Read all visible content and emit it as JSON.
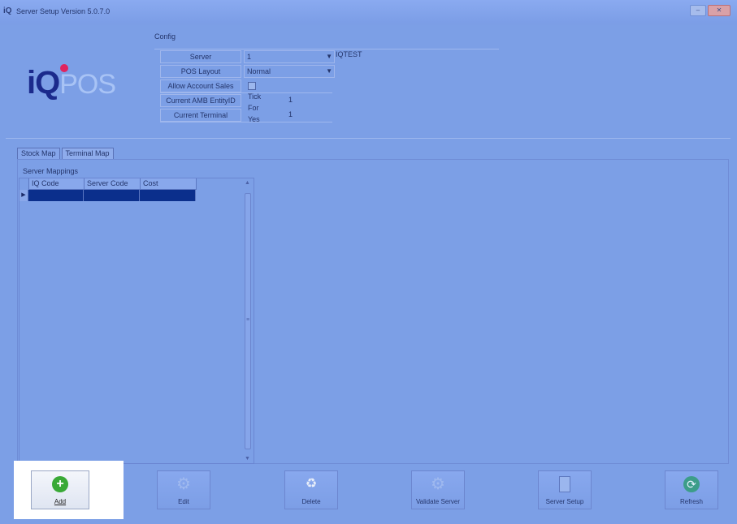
{
  "window": {
    "title": "Server Setup Version 5.0.7.0",
    "title_logo": "iQ",
    "buttons": [
      "–",
      "✕"
    ]
  },
  "logo": {
    "iq": "iQ",
    "pos": "POS"
  },
  "config": {
    "title": "Config",
    "server_label": "Server",
    "server_value": "1",
    "server_name": "IQTEST",
    "pos_layout_label": "POS Layout",
    "pos_layout_value": "Normal",
    "allow_account_sales_label": "Allow Account Sales",
    "allow_account_sales_checkbox": "Tick For Yes",
    "amb_entity_label": "Current AMB EntityID",
    "amb_entity_value": "1",
    "terminal_label": "Current Terminal",
    "terminal_value": "1"
  },
  "tabs": [
    "Stock Map",
    "Terminal Map"
  ],
  "mappings": {
    "group_label": "Server Mappings",
    "columns": [
      "IQ Code",
      "Server Code",
      "Cost"
    ],
    "row_indicator": "▶"
  },
  "toolbar": {
    "add": "Add",
    "edit": "Edit",
    "delete": "Delete",
    "validate": "Validate Server",
    "server_setup": "Server Setup",
    "refresh": "Refresh"
  },
  "colors": {
    "background": "#7c9fe6",
    "selected_row": "#0b2f8c",
    "logo_dot": "#e0245f",
    "add_icon": "#39a936"
  }
}
